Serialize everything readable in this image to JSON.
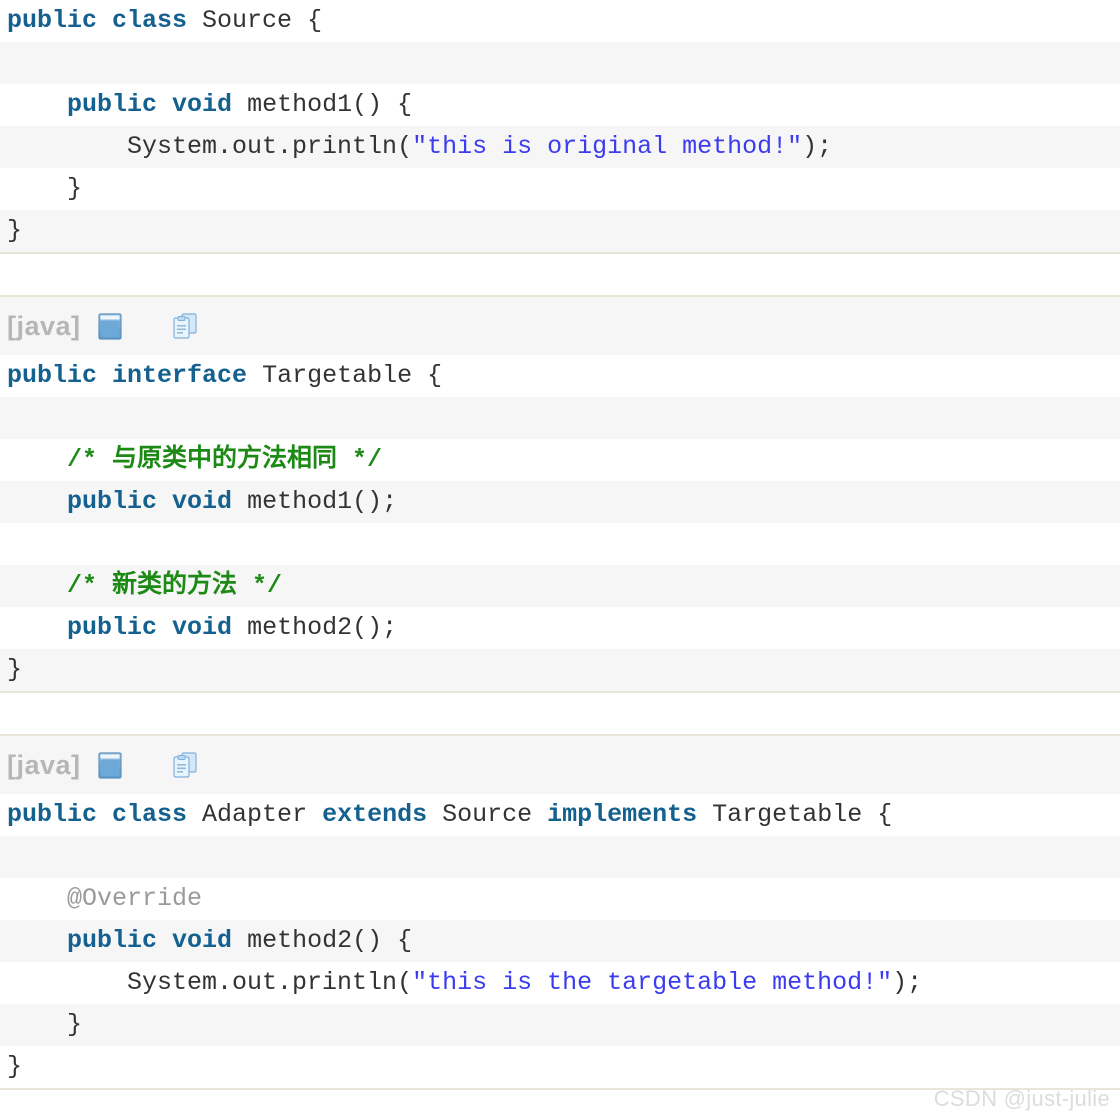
{
  "page": {
    "background_color": "#ffffff",
    "watermark": "CSDN @just-julie"
  },
  "colors": {
    "keyword": "#14618f",
    "string": "#3b3bf0",
    "comment": "#1d8a16",
    "annotation": "#9a9a9a",
    "plain": "#333333",
    "row_stripe": "#f6f6f6",
    "row_base": "#ffffff",
    "block_border": "#e9e5d9",
    "lang_label": "#b6b6b6",
    "watermark": "#dcdcdc"
  },
  "toolbar": {
    "lang_label": "[java]",
    "view_icon_name": "view-plain-icon",
    "copy_icon_name": "copy-to-clipboard-icon"
  },
  "blocks": [
    {
      "id": "source-class",
      "has_toolbar": false,
      "lines": [
        {
          "stripe": "odd",
          "tokens": [
            {
              "t": "kw",
              "v": "public"
            },
            {
              "t": "pln",
              "v": " "
            },
            {
              "t": "kw",
              "v": "class"
            },
            {
              "t": "pln",
              "v": " Source {"
            }
          ]
        },
        {
          "stripe": "even",
          "tokens": [
            {
              "t": "pln",
              "v": ""
            }
          ]
        },
        {
          "stripe": "odd",
          "tokens": [
            {
              "t": "pln",
              "v": "    "
            },
            {
              "t": "kw",
              "v": "public"
            },
            {
              "t": "pln",
              "v": " "
            },
            {
              "t": "kw",
              "v": "void"
            },
            {
              "t": "pln",
              "v": " method1() {"
            }
          ]
        },
        {
          "stripe": "even",
          "tokens": [
            {
              "t": "pln",
              "v": "        System.out.println("
            },
            {
              "t": "str",
              "v": "\"this is original method!\""
            },
            {
              "t": "pln",
              "v": ");"
            }
          ]
        },
        {
          "stripe": "odd",
          "tokens": [
            {
              "t": "pln",
              "v": "    }"
            }
          ]
        },
        {
          "stripe": "even",
          "tokens": [
            {
              "t": "pln",
              "v": "}"
            }
          ]
        }
      ]
    },
    {
      "id": "targetable-interface",
      "has_toolbar": true,
      "lines": [
        {
          "stripe": "odd",
          "tokens": [
            {
              "t": "kw",
              "v": "public"
            },
            {
              "t": "pln",
              "v": " "
            },
            {
              "t": "kw",
              "v": "interface"
            },
            {
              "t": "pln",
              "v": " Targetable {"
            }
          ]
        },
        {
          "stripe": "even",
          "tokens": [
            {
              "t": "pln",
              "v": ""
            }
          ]
        },
        {
          "stripe": "odd",
          "tokens": [
            {
              "t": "pln",
              "v": "    "
            },
            {
              "t": "cmt",
              "v": "/* 与原类中的方法相同 */"
            }
          ]
        },
        {
          "stripe": "even",
          "tokens": [
            {
              "t": "pln",
              "v": "    "
            },
            {
              "t": "kw",
              "v": "public"
            },
            {
              "t": "pln",
              "v": " "
            },
            {
              "t": "kw",
              "v": "void"
            },
            {
              "t": "pln",
              "v": " method1();"
            }
          ]
        },
        {
          "stripe": "odd",
          "tokens": [
            {
              "t": "pln",
              "v": ""
            }
          ]
        },
        {
          "stripe": "even",
          "tokens": [
            {
              "t": "pln",
              "v": "    "
            },
            {
              "t": "cmt",
              "v": "/* 新类的方法 */"
            }
          ]
        },
        {
          "stripe": "odd",
          "tokens": [
            {
              "t": "pln",
              "v": "    "
            },
            {
              "t": "kw",
              "v": "public"
            },
            {
              "t": "pln",
              "v": " "
            },
            {
              "t": "kw",
              "v": "void"
            },
            {
              "t": "pln",
              "v": " method2();"
            }
          ]
        },
        {
          "stripe": "even",
          "tokens": [
            {
              "t": "pln",
              "v": "}"
            }
          ]
        }
      ]
    },
    {
      "id": "adapter-class",
      "has_toolbar": true,
      "lines": [
        {
          "stripe": "odd",
          "tokens": [
            {
              "t": "kw",
              "v": "public"
            },
            {
              "t": "pln",
              "v": " "
            },
            {
              "t": "kw",
              "v": "class"
            },
            {
              "t": "pln",
              "v": " Adapter "
            },
            {
              "t": "kw",
              "v": "extends"
            },
            {
              "t": "pln",
              "v": " Source "
            },
            {
              "t": "kw",
              "v": "implements"
            },
            {
              "t": "pln",
              "v": " Targetable {"
            }
          ]
        },
        {
          "stripe": "even",
          "tokens": [
            {
              "t": "pln",
              "v": ""
            }
          ]
        },
        {
          "stripe": "odd",
          "tokens": [
            {
              "t": "pln",
              "v": "    "
            },
            {
              "t": "ann",
              "v": "@Override"
            }
          ]
        },
        {
          "stripe": "even",
          "tokens": [
            {
              "t": "pln",
              "v": "    "
            },
            {
              "t": "kw",
              "v": "public"
            },
            {
              "t": "pln",
              "v": " "
            },
            {
              "t": "kw",
              "v": "void"
            },
            {
              "t": "pln",
              "v": " method2() {"
            }
          ]
        },
        {
          "stripe": "odd",
          "tokens": [
            {
              "t": "pln",
              "v": "        System.out.println("
            },
            {
              "t": "str",
              "v": "\"this is the targetable method!\""
            },
            {
              "t": "pln",
              "v": ");"
            }
          ]
        },
        {
          "stripe": "even",
          "tokens": [
            {
              "t": "pln",
              "v": "    }"
            }
          ]
        },
        {
          "stripe": "odd",
          "tokens": [
            {
              "t": "pln",
              "v": "}"
            }
          ]
        }
      ]
    }
  ]
}
